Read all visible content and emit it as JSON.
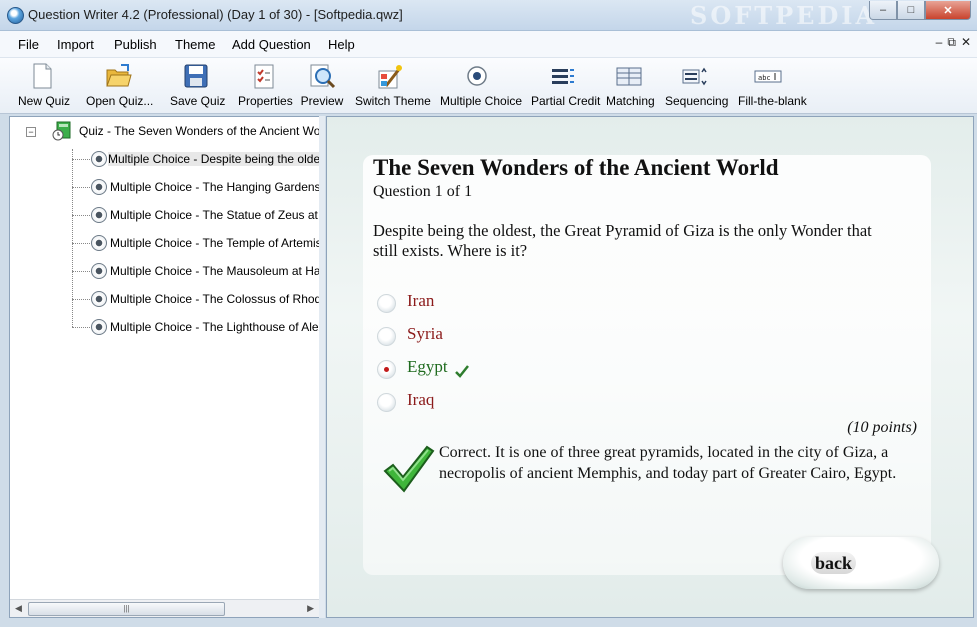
{
  "window": {
    "title": "Question Writer 4.2 (Professional) (Day 1 of 30) - [Softpedia.qwz]",
    "watermark": "SOFTPEDIA"
  },
  "menu": [
    "File",
    "Import",
    "Publish",
    "Theme",
    "Add Question",
    "Help"
  ],
  "toolbar": [
    {
      "label": "New Quiz",
      "icon": "new-quiz-icon"
    },
    {
      "label": "Open Quiz...",
      "icon": "open-folder-icon"
    },
    {
      "label": "Save Quiz",
      "icon": "save-disk-icon"
    },
    {
      "label": "Properties",
      "icon": "properties-icon"
    },
    {
      "label": "Preview",
      "icon": "preview-magnifier-icon"
    },
    {
      "label": "Switch Theme",
      "icon": "switch-theme-icon"
    },
    {
      "label": "Multiple Choice",
      "icon": "multiple-choice-icon"
    },
    {
      "label": "Partial Credit",
      "icon": "partial-credit-icon"
    },
    {
      "label": "Matching",
      "icon": "matching-icon"
    },
    {
      "label": "Sequencing",
      "icon": "sequencing-icon"
    },
    {
      "label": "Fill-the-blank",
      "icon": "fill-the-blank-icon"
    }
  ],
  "tree": {
    "root": "Quiz - The Seven Wonders of the Ancient World",
    "items": [
      "Multiple Choice - Despite being the oldest, the",
      "Multiple Choice - The Hanging Gardens of Ba",
      "Multiple Choice - The Statue of Zeus at Olym",
      "Multiple Choice - The Temple of Artemis at Ep",
      "Multiple Choice - The Mausoleum at Halicarn",
      "Multiple Choice - The Colossus of Rhodes wa",
      "Multiple Choice - The Lighthouse of Alexandr"
    ],
    "selected_index": 0
  },
  "preview": {
    "title": "The Seven Wonders of the Ancient World",
    "question_number": "Question 1 of 1",
    "question_text": "Despite being the oldest, the Great Pyramid of Giza is the only Wonder that still exists. Where is it?",
    "answers": [
      {
        "text": "Iran",
        "selected": false,
        "correct": false
      },
      {
        "text": "Syria",
        "selected": false,
        "correct": false
      },
      {
        "text": "Egypt",
        "selected": true,
        "correct": true
      },
      {
        "text": "Iraq",
        "selected": false,
        "correct": false
      }
    ],
    "points": "(10 points)",
    "feedback": "Correct. It is one of three great pyramids, located in the city of Giza, a necropolis of ancient Memphis, and today part of Greater Cairo, Egypt.",
    "back_label": "back",
    "colors": {
      "answer": "#8b1a1a",
      "correct_answer": "#1f6b1f",
      "check": "#3aa32e"
    }
  }
}
